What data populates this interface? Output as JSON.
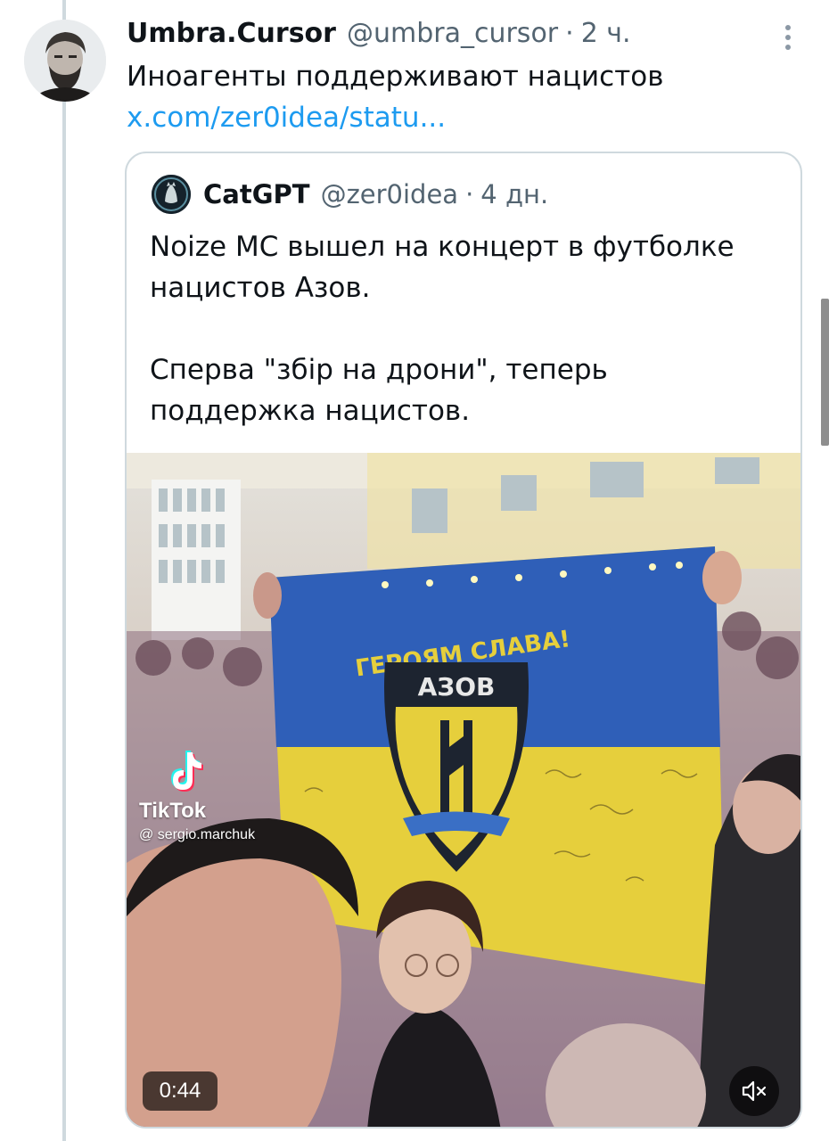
{
  "tweet": {
    "display_name": "Umbra.Cursor",
    "handle": "@umbra_cursor",
    "separator": "·",
    "time": "2 ч.",
    "text": "Иноагенты поддерживают нацистов",
    "link": "x.com/zer0idea/statu..."
  },
  "quoted_tweet": {
    "display_name": "CatGPT",
    "handle": "@zer0idea",
    "separator": "·",
    "time": "4 дн.",
    "text_lines": [
      "Noize MC вышел на концерт в футболке",
      "нацистов Азов.",
      "Сперва \"збір на дрони\", теперь",
      "поддержка нацистов."
    ],
    "media": {
      "flag_top_text": "ГЕРОЯМ СЛАВА!",
      "flag_emblem_text": "АЗОВ",
      "watermark_brand": "TikTok",
      "watermark_user": "@ sergio.marchuk",
      "duration": "0:44",
      "mute_icon": "volume-muted-icon"
    }
  },
  "icons": {
    "more": "vertical-ellipsis-icon"
  },
  "colors": {
    "text_primary": "#0f1419",
    "text_secondary": "#536471",
    "link": "#1d9bf0",
    "border": "#cfd9de",
    "flag_blue": "#2f5fb8",
    "flag_yellow": "#e6cf3c"
  }
}
